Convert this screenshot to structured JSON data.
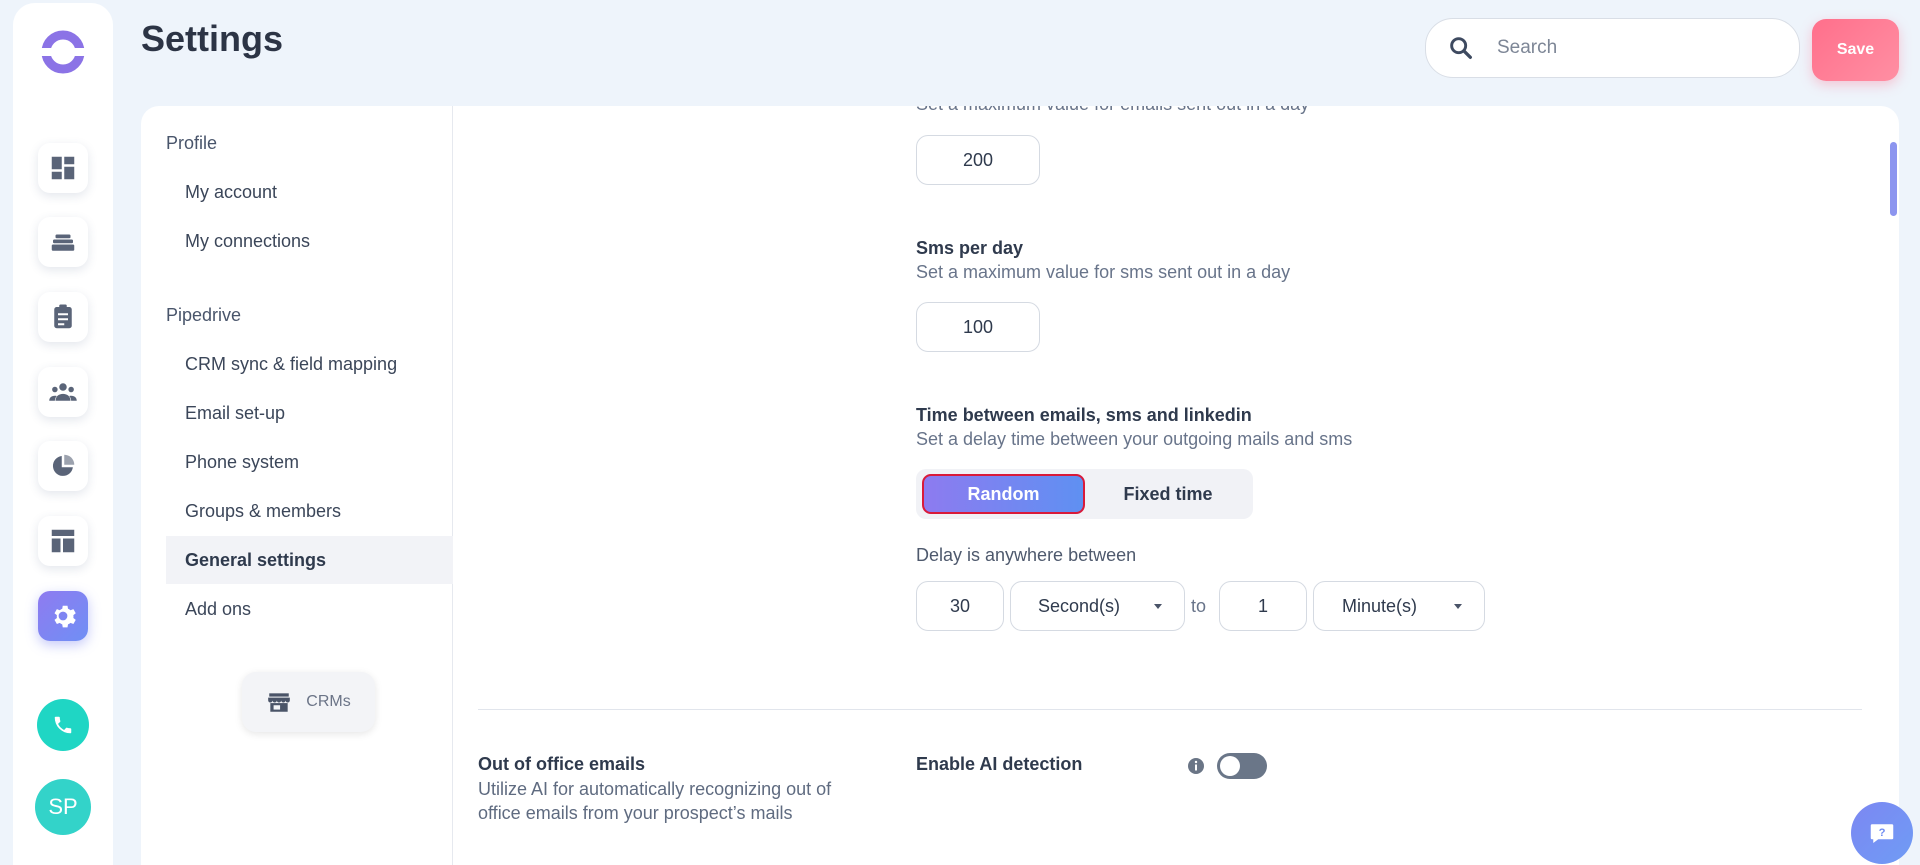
{
  "header": {
    "title": "Settings",
    "search_placeholder": "Search",
    "save_label": "Save"
  },
  "rail": {
    "items": [
      "dashboard-icon",
      "layers-icon",
      "clipboard-icon",
      "team-icon",
      "pie-chart-icon",
      "layout-icon",
      "gear-icon"
    ],
    "active": "gear-icon",
    "avatar_initials": "SP"
  },
  "settings_nav": {
    "sections": [
      {
        "title": "Profile",
        "items": [
          "My account",
          "My connections"
        ]
      },
      {
        "title": "Pipedrive",
        "items": [
          "CRM sync & field mapping",
          "Email set-up",
          "Phone system",
          "Groups & members",
          "General settings",
          "Add ons"
        ]
      }
    ],
    "active_item": "General settings",
    "crm_button_label": "CRMs"
  },
  "content": {
    "emails_per_day_desc": "Set a maximum value for emails sent out in a day",
    "emails_per_day_value": "200",
    "sms_label": "Sms per day",
    "sms_desc": "Set a maximum value for sms sent out in a day",
    "sms_value": "100",
    "time_label": "Time between emails, sms and linkedin",
    "time_desc": "Set a delay time between your outgoing mails and sms",
    "mode_random": "Random",
    "mode_fixed": "Fixed time",
    "selected_mode": "Random",
    "delay_label": "Delay is anywhere between",
    "delay_from_value": "30",
    "delay_from_unit": "Second(s)",
    "to_label": "to",
    "delay_to_value": "1",
    "delay_to_unit": "Minute(s)",
    "ooo_label": "Out of office emails",
    "ooo_desc_line1": "Utilize AI for automatically recognizing out of",
    "ooo_desc_line2": "office emails from your prospect’s mails",
    "ai_detect_label": "Enable AI detection",
    "ai_detect_enabled": false
  },
  "colors": {
    "accent": "#7b8cf2",
    "save": "#ff7a93",
    "phone": "#1fd6c4",
    "avatar": "#33d3c9"
  }
}
